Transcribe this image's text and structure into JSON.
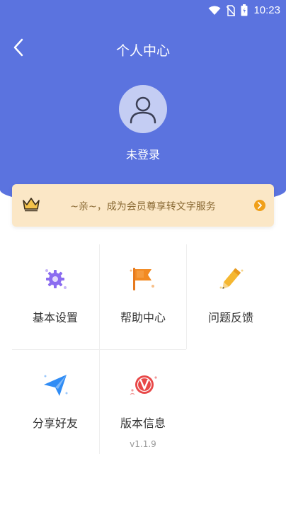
{
  "status_bar": {
    "time": "10:23"
  },
  "nav": {
    "title": "个人中心"
  },
  "profile": {
    "login_label": "未登录"
  },
  "member_banner": {
    "text": "~亲~，成为会员尊享转文字服务"
  },
  "menu": [
    {
      "label": "基本设置",
      "icon": "settings-gear-icon"
    },
    {
      "label": "帮助中心",
      "icon": "flag-icon"
    },
    {
      "label": "问题反馈",
      "icon": "pencil-icon"
    },
    {
      "label": "分享好友",
      "icon": "paper-plane-icon"
    },
    {
      "label": "版本信息",
      "icon": "version-v-icon",
      "sub": "v1.1.9"
    }
  ],
  "colors": {
    "header": "#5b73df",
    "banner": "#fbe7c6",
    "accent_orange": "#f0a019",
    "purple": "#8b6cf0",
    "blue": "#2f8cf5",
    "red": "#e84848"
  }
}
